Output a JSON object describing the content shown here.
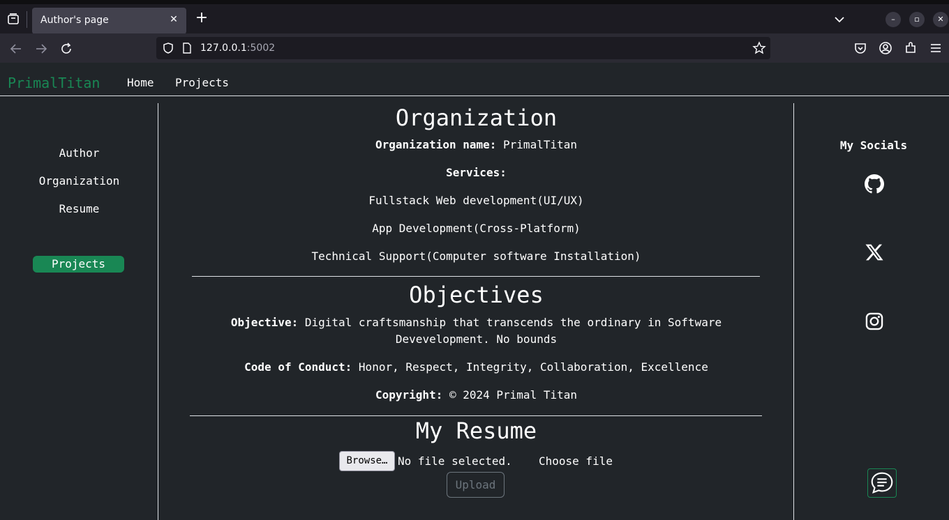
{
  "browser": {
    "tab_title": "Author's page",
    "url_host": "127.0.0.1",
    "url_port": ":5002"
  },
  "navbar": {
    "brand": "PrimalTitan",
    "links": [
      "Home",
      "Projects"
    ]
  },
  "sidebar": {
    "items": [
      "Author",
      "Organization",
      "Resume"
    ],
    "projects_button": "Projects"
  },
  "organization": {
    "heading": "Organization",
    "name_label": "Organization name:",
    "name_value": "PrimalTitan",
    "services_label": "Services:",
    "services": [
      "Fullstack Web development(UI/UX)",
      "App Development(Cross-Platform)",
      "Technical Support(Computer software Installation)"
    ]
  },
  "objectives": {
    "heading": "Objectives",
    "objective_label": "Objective:",
    "objective_line1": "Digital craftsmanship that transcends the ordinary in Software",
    "objective_line2": "Devevelopment. No bounds",
    "conduct_label": "Code of Conduct:",
    "conduct_value": "Honor, Respect, Integrity, Collaboration, Excellence",
    "copyright_label": "Copyright:",
    "copyright_value": "© 2024 Primal Titan"
  },
  "resume": {
    "heading": "My Resume",
    "browse_label": "Browse…",
    "file_status": "No file selected.",
    "choose_label": "Choose file",
    "upload_label": "Upload"
  },
  "socials": {
    "title": "My Socials",
    "icons": [
      "github-icon",
      "x-icon",
      "instagram-icon"
    ]
  },
  "colors": {
    "brand": "#198754",
    "background": "#212529"
  }
}
